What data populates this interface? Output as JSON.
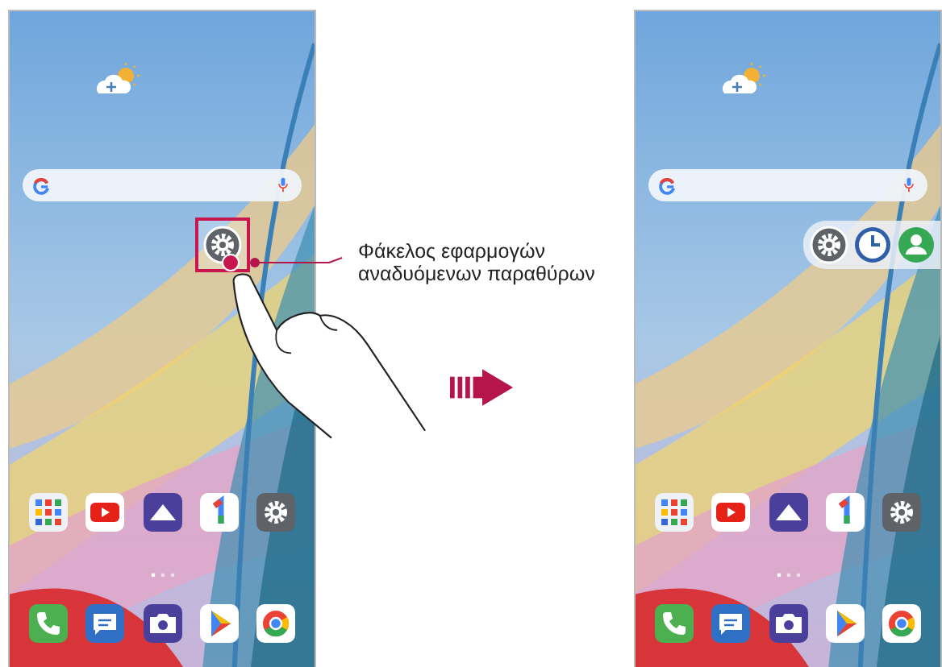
{
  "screens": [
    {
      "folder": {
        "expanded": false,
        "touched": true,
        "apps": [
          {
            "kind": "gear"
          }
        ]
      }
    },
    {
      "folder": {
        "expanded": true,
        "touched": false,
        "apps": [
          {
            "kind": "gear"
          },
          {
            "kind": "clock"
          },
          {
            "kind": "person"
          }
        ]
      }
    }
  ],
  "callout": {
    "label": "Φάκελος εφαρμογών αναδυόμενων παραθύρων"
  }
}
